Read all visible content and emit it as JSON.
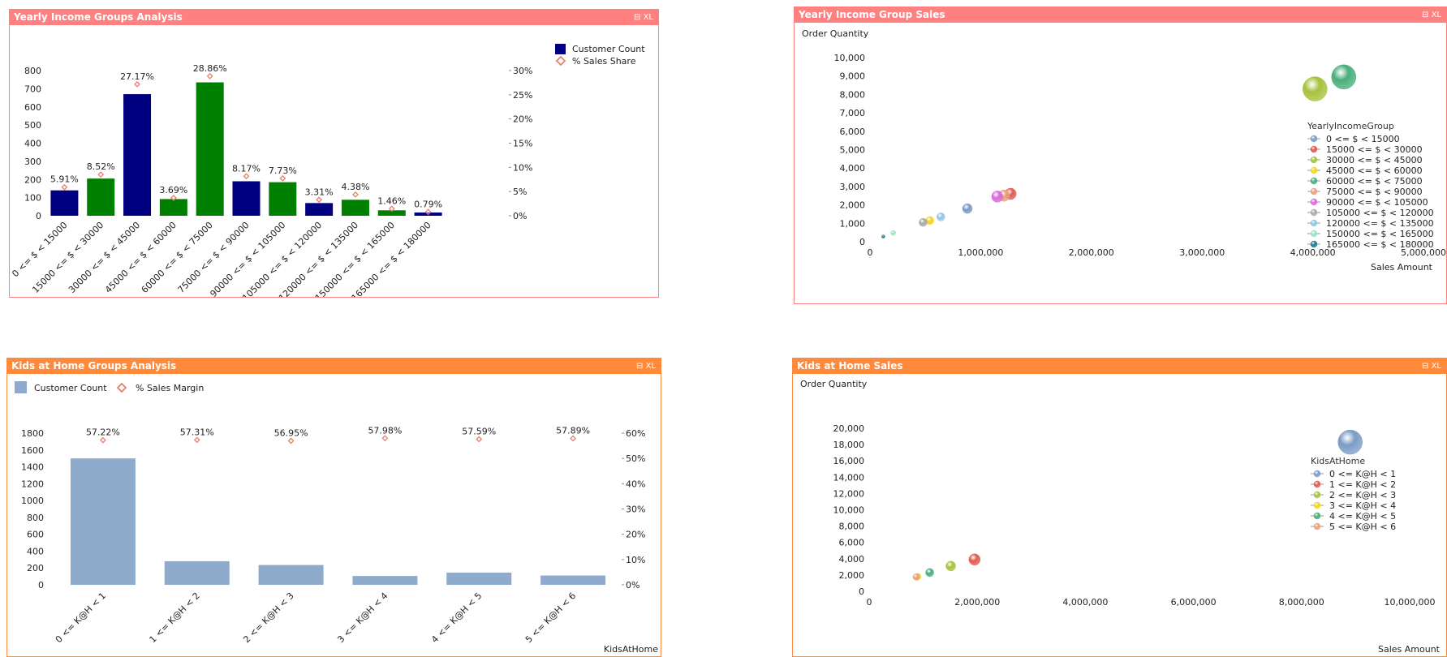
{
  "colors": {
    "caption_red": "#ff8080",
    "caption_orange": "#ff8a3c",
    "navy": "#000080",
    "green": "#008000",
    "steel": "#8fabcc",
    "marker": "#e8806a"
  },
  "panels": [
    {
      "title": "Yearly Income Groups Analysis",
      "controls": "⊟ XL"
    },
    {
      "title": "Yearly Income Group Sales",
      "controls": "⊟ XL"
    },
    {
      "title": "Kids at Home Groups Analysis",
      "controls": "⊟ XL"
    },
    {
      "title": "Kids at Home Sales",
      "controls": "⊟ XL"
    }
  ],
  "chart_data": [
    {
      "type": "bar",
      "title": "Yearly Income Groups Analysis",
      "categories": [
        "0 <= $ < 15000",
        "15000 <= $ < 30000",
        "30000 <= $ < 45000",
        "45000 <= $ < 60000",
        "60000 <= $ < 75000",
        "75000 <= $ < 90000",
        "90000 <= $ < 105000",
        "105000 <= $ < 120000",
        "120000 <= $ < 135000",
        "150000 <= $ < 165000",
        "165000 <= $ < 180000"
      ],
      "series": [
        {
          "name": "Customer Count",
          "axis": "left",
          "values": [
            140,
            205,
            670,
            92,
            735,
            190,
            185,
            70,
            88,
            30,
            18
          ],
          "bar_colors": [
            "navy",
            "green",
            "navy",
            "green",
            "green",
            "navy",
            "green",
            "navy",
            "green",
            "green",
            "navy"
          ]
        },
        {
          "name": "% Sales Share",
          "axis": "right",
          "marker": "diamond",
          "values": [
            5.91,
            8.52,
            27.17,
            3.69,
            28.86,
            8.17,
            7.73,
            3.31,
            4.38,
            1.46,
            0.79
          ],
          "labels": [
            "5.91%",
            "8.52%",
            "27.17%",
            "3.69%",
            "28.86%",
            "8.17%",
            "7.73%",
            "3.31%",
            "4.38%",
            "1.46%",
            "0.79%"
          ]
        }
      ],
      "ylim": [
        0,
        800
      ],
      "yticks": [
        "0",
        "100",
        "200",
        "300",
        "400",
        "500",
        "600",
        "700",
        "800"
      ],
      "y2lim": [
        0,
        30
      ],
      "y2ticks": [
        "0%",
        "5%",
        "10%",
        "15%",
        "20%",
        "25%",
        "30%"
      ],
      "legend": [
        {
          "name": "Customer Count",
          "shape": "square",
          "color": "navy"
        },
        {
          "name": "% Sales Share",
          "shape": "diamond",
          "color": "marker"
        }
      ],
      "legend_position": "top-right"
    },
    {
      "type": "scatter",
      "title": "Yearly Income Group Sales",
      "xlabel": "Sales Amount",
      "ylabel": "Order Quantity",
      "xlim": [
        0,
        5000000
      ],
      "ylim": [
        0,
        10000
      ],
      "xticks": [
        "0",
        "1,000,000",
        "2,000,000",
        "3,000,000",
        "4,000,000",
        "5,000,000"
      ],
      "yticks": [
        "0",
        "1,000",
        "2,000",
        "3,000",
        "4,000",
        "5,000",
        "6,000",
        "7,000",
        "8,000",
        "9,000",
        "10,000"
      ],
      "legend_title": "YearlyIncomeGroup",
      "legend_position": "right",
      "series": [
        {
          "name": "0 <= $ < 15000",
          "color": "#7b9bc6",
          "points": [
            {
              "x": 880000,
              "y": 1800,
              "size": 6
            }
          ]
        },
        {
          "name": "15000 <= $ < 30000",
          "color": "#e05a50",
          "points": [
            {
              "x": 1270000,
              "y": 2600,
              "size": 7
            }
          ]
        },
        {
          "name": "30000 <= $ < 45000",
          "color": "#a6c13c",
          "points": [
            {
              "x": 4020000,
              "y": 8300,
              "size": 15
            }
          ]
        },
        {
          "name": "45000 <= $ < 60000",
          "color": "#f4d31e",
          "points": [
            {
              "x": 540000,
              "y": 1150,
              "size": 5
            }
          ]
        },
        {
          "name": "60000 <= $ < 75000",
          "color": "#4aad7b",
          "points": [
            {
              "x": 4280000,
              "y": 8950,
              "size": 15
            }
          ]
        },
        {
          "name": "75000 <= $ < 90000",
          "color": "#e8a07a",
          "points": [
            {
              "x": 1210000,
              "y": 2500,
              "size": 7
            }
          ]
        },
        {
          "name": "90000 <= $ < 105000",
          "color": "#d86ad8",
          "points": [
            {
              "x": 1150000,
              "y": 2450,
              "size": 7
            }
          ]
        },
        {
          "name": "105000 <= $ < 120000",
          "color": "#a8a8a8",
          "points": [
            {
              "x": 480000,
              "y": 1050,
              "size": 5
            }
          ]
        },
        {
          "name": "120000 <= $ < 135000",
          "color": "#8ec6e4",
          "points": [
            {
              "x": 640000,
              "y": 1350,
              "size": 5
            }
          ]
        },
        {
          "name": "150000 <= $ < 165000",
          "color": "#9ee0c4",
          "points": [
            {
              "x": 210000,
              "y": 480,
              "size": 3
            }
          ]
        },
        {
          "name": "165000 <= $ < 180000",
          "color": "#1d7a8c",
          "points": [
            {
              "x": 120000,
              "y": 280,
              "size": 2
            }
          ]
        }
      ]
    },
    {
      "type": "bar",
      "title": "Kids at Home Groups Analysis",
      "xlabel": "KidsAtHome",
      "categories": [
        "0 <= K@H < 1",
        "1 <= K@H < 2",
        "2 <= K@H < 3",
        "3 <= K@H < 4",
        "4 <= K@H < 5",
        "5 <= K@H < 6"
      ],
      "series": [
        {
          "name": "Customer Count",
          "axis": "left",
          "values": [
            1500,
            280,
            235,
            105,
            145,
            110
          ]
        },
        {
          "name": "% Sales Margin",
          "axis": "right",
          "marker": "diamond",
          "values": [
            57.22,
            57.31,
            56.95,
            57.98,
            57.59,
            57.89
          ],
          "labels": [
            "57.22%",
            "57.31%",
            "56.95%",
            "57.98%",
            "57.59%",
            "57.89%"
          ]
        }
      ],
      "ylim": [
        0,
        1800
      ],
      "yticks": [
        "0",
        "200",
        "400",
        "600",
        "800",
        "1000",
        "1200",
        "1400",
        "1600",
        "1800"
      ],
      "y2lim": [
        0,
        60
      ],
      "y2ticks": [
        "0%",
        "10%",
        "20%",
        "30%",
        "40%",
        "50%",
        "60%"
      ],
      "legend": [
        {
          "name": "Customer Count",
          "shape": "square",
          "color": "steel"
        },
        {
          "name": "% Sales Margin",
          "shape": "diamond",
          "color": "marker"
        }
      ],
      "legend_position": "top-left"
    },
    {
      "type": "scatter",
      "title": "Kids at Home Sales",
      "xlabel": "Sales Amount",
      "ylabel": "Order Quantity",
      "xlim": [
        0,
        10000000
      ],
      "ylim": [
        0,
        20000
      ],
      "xticks": [
        "0",
        "2,000,000",
        "4,000,000",
        "6,000,000",
        "8,000,000",
        "10,000,000"
      ],
      "yticks": [
        "0",
        "2,000",
        "4,000",
        "6,000",
        "8,000",
        "10,000",
        "12,000",
        "14,000",
        "16,000",
        "18,000",
        "20,000"
      ],
      "legend_title": "KidsAtHome",
      "legend_position": "right",
      "series": [
        {
          "name": "0 <= K@H < 1",
          "color": "#7b9bc6",
          "points": [
            {
              "x": 8900000,
              "y": 18300,
              "size": 15
            }
          ]
        },
        {
          "name": "1 <= K@H < 2",
          "color": "#e05a50",
          "points": [
            {
              "x": 1950000,
              "y": 3900,
              "size": 7
            }
          ]
        },
        {
          "name": "2 <= K@H < 3",
          "color": "#a6c13c",
          "points": [
            {
              "x": 1510000,
              "y": 3100,
              "size": 6
            }
          ]
        },
        {
          "name": "3 <= K@H < 4",
          "color": "#f4d31e",
          "points": [
            {
              "x": 900000,
              "y": 1800,
              "size": 4
            }
          ]
        },
        {
          "name": "4 <= K@H < 5",
          "color": "#4aad7b",
          "points": [
            {
              "x": 1120000,
              "y": 2300,
              "size": 5
            }
          ]
        },
        {
          "name": "5 <= K@H < 6",
          "color": "#e8a07a",
          "points": [
            {
              "x": 870000,
              "y": 1750,
              "size": 4
            }
          ]
        }
      ]
    }
  ]
}
